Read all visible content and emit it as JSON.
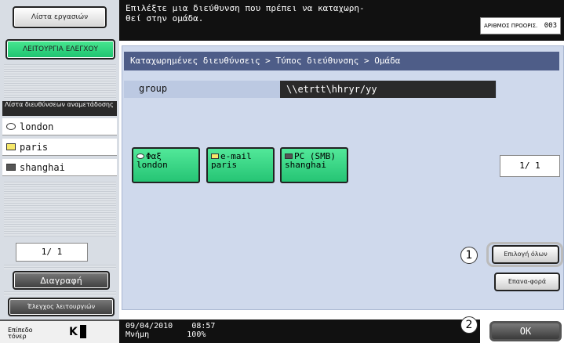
{
  "left": {
    "job_list_btn": "Λίστα εργασιών",
    "check_function_btn": "ΛΕΙΤΟΥΡΓΙΑ ΕΛΕΓΧΟΥ",
    "list_header": "Λίστα διευθύνσεων αναμετάδοσης",
    "items": [
      {
        "label": "london",
        "icon": "fax-icon"
      },
      {
        "label": "paris",
        "icon": "email-icon"
      },
      {
        "label": "shanghai",
        "icon": "pc-smb-icon"
      }
    ],
    "page_indicator": "1/  1",
    "delete_btn": "Διαγραφή",
    "check_functions_btn": "Έλεγχος λειτουργιών",
    "toner_label": "Επίπεδο τόνερ",
    "toner_value": "K"
  },
  "header": {
    "message": "Επιλέξτε μια διεύθυνση που πρέπει να καταχωρη-\nθεί στην ομάδα.",
    "counter_label": "ΑΡΙΘΜΟΣ ΠΡΟΟΡΙΣ.",
    "counter_value": "003"
  },
  "main": {
    "breadcrumb": "Καταχωρημένες διευθύνσεις > Τύπος διεύθυνσης > Ομάδα",
    "group_label": "group",
    "group_path": "\\\\etrtt\\hhryr/yy",
    "destinations": [
      {
        "type": "Φαξ",
        "name": "london",
        "icon": "fax-icon"
      },
      {
        "type": "e-mail",
        "name": "paris",
        "icon": "email-icon"
      },
      {
        "type": "PC (SMB)",
        "name": "shanghai",
        "icon": "pc-smb-icon"
      }
    ],
    "dest_page_indicator": "1/  1",
    "select_all_btn": "Επιλογή όλων",
    "reset_btn": "Επανα-φορά",
    "ok_btn": "OK"
  },
  "status": {
    "date": "09/04/2010",
    "time": "08:57",
    "memory_label": "Μνήμη",
    "memory_value": "100%"
  },
  "callouts": [
    "1",
    "2"
  ]
}
